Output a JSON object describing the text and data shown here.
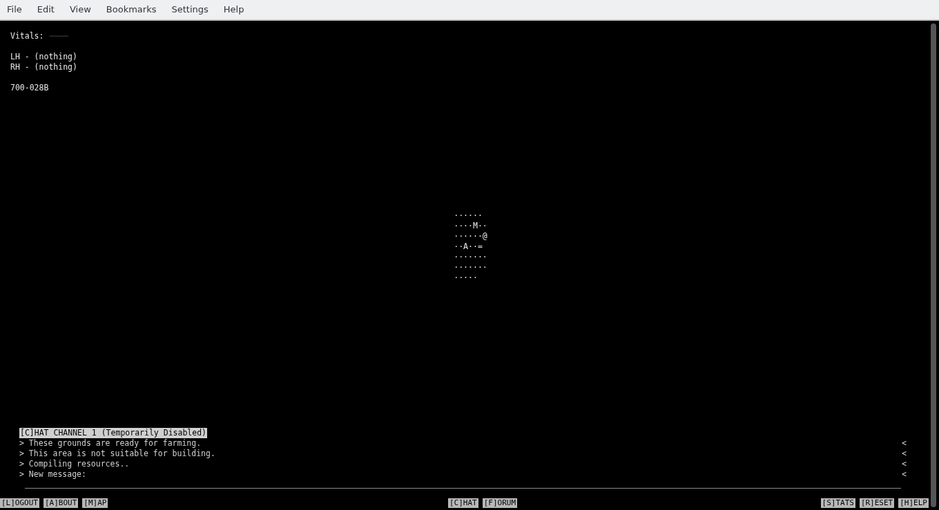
{
  "menu": [
    "File",
    "Edit",
    "View",
    "Bookmarks",
    "Settings",
    "Help"
  ],
  "status": {
    "vitals_label": "Vitals:",
    "vitals_value": "────",
    "hands": [
      "LH - (nothing)",
      "RH - (nothing)"
    ],
    "code": "700-028B"
  },
  "map": [
    "······",
    "····M··",
    "······@",
    "··A··=",
    "·······",
    "·······",
    "·····"
  ],
  "chat": {
    "header": "[C]HAT CHANNEL 1 (Temporarily Disabled)",
    "messages": [
      {
        "text": "> These grounds are ready for farming.",
        "marker": "<"
      },
      {
        "text": "> This area is not suitable for building.",
        "marker": "<"
      },
      {
        "text": "> Compiling resources..",
        "marker": "<"
      },
      {
        "text": "> New message:",
        "marker": "<"
      }
    ]
  },
  "footer": {
    "left": [
      "[L]OGOUT",
      "[A]BOUT",
      "[M]AP"
    ],
    "center": [
      "[C]HAT",
      "[F]ORUM"
    ],
    "right": [
      "[S]TATS",
      "[R]ESET",
      "[H]ELP"
    ]
  }
}
